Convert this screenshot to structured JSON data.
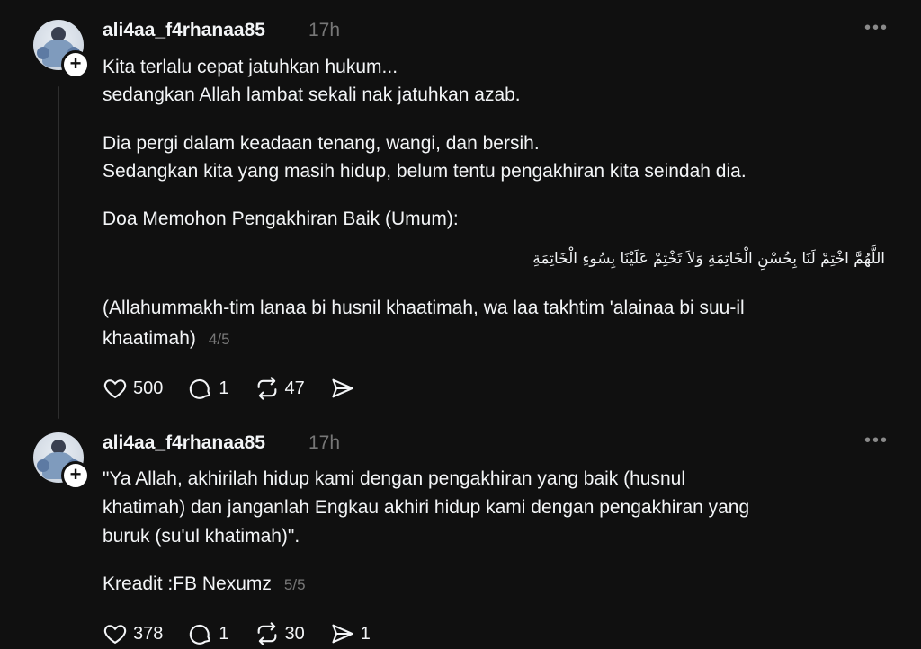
{
  "posts": [
    {
      "username": "ali4aa_f4rhanaa85",
      "time": "17h",
      "paragraphs": [
        "Kita terlalu cepat jatuhkan hukum...",
        "sedangkan Allah lambat sekali nak jatuhkan azab.",
        "Dia pergi dalam keadaan tenang, wangi, dan bersih.",
        "Sedangkan kita yang masih hidup, belum tentu pengakhiran kita seindah dia.",
        "Doa Memohon Pengakhiran Baik (Umum):"
      ],
      "arabic": "اللَّهُمَّ اخْتِمْ لَنَا بِحُسْنِ الْخَاتِمَةِ وَلاَ تَخْتِمْ عَلَيْنَا بِسُوءِ الْخَاتِمَةِ",
      "transliteration_line1": "(Allahummakh-tim lanaa bi husnil khaatimah, wa laa takhtim 'alainaa bi suu-il",
      "transliteration_line2": "khaatimah)",
      "page": "4/5",
      "likes": "500",
      "replies": "1",
      "reposts": "47",
      "shares": ""
    },
    {
      "username": "ali4aa_f4rhanaa85",
      "time": "17h",
      "quote_line1": "\"Ya Allah, akhirilah hidup kami dengan pengakhiran yang baik (husnul",
      "quote_line2": "khatimah) dan janganlah Engkau akhiri hidup kami dengan pengakhiran yang",
      "quote_line3": "buruk (su'ul khatimah)\".",
      "credit": "Kreadit :FB Nexumz",
      "page": "5/5",
      "likes": "378",
      "replies": "1",
      "reposts": "30",
      "shares": "1"
    }
  ],
  "more_icon": "ellipsis-icon",
  "colors": {
    "background": "#101010",
    "text": "#f3f5f7",
    "muted": "#777777"
  }
}
